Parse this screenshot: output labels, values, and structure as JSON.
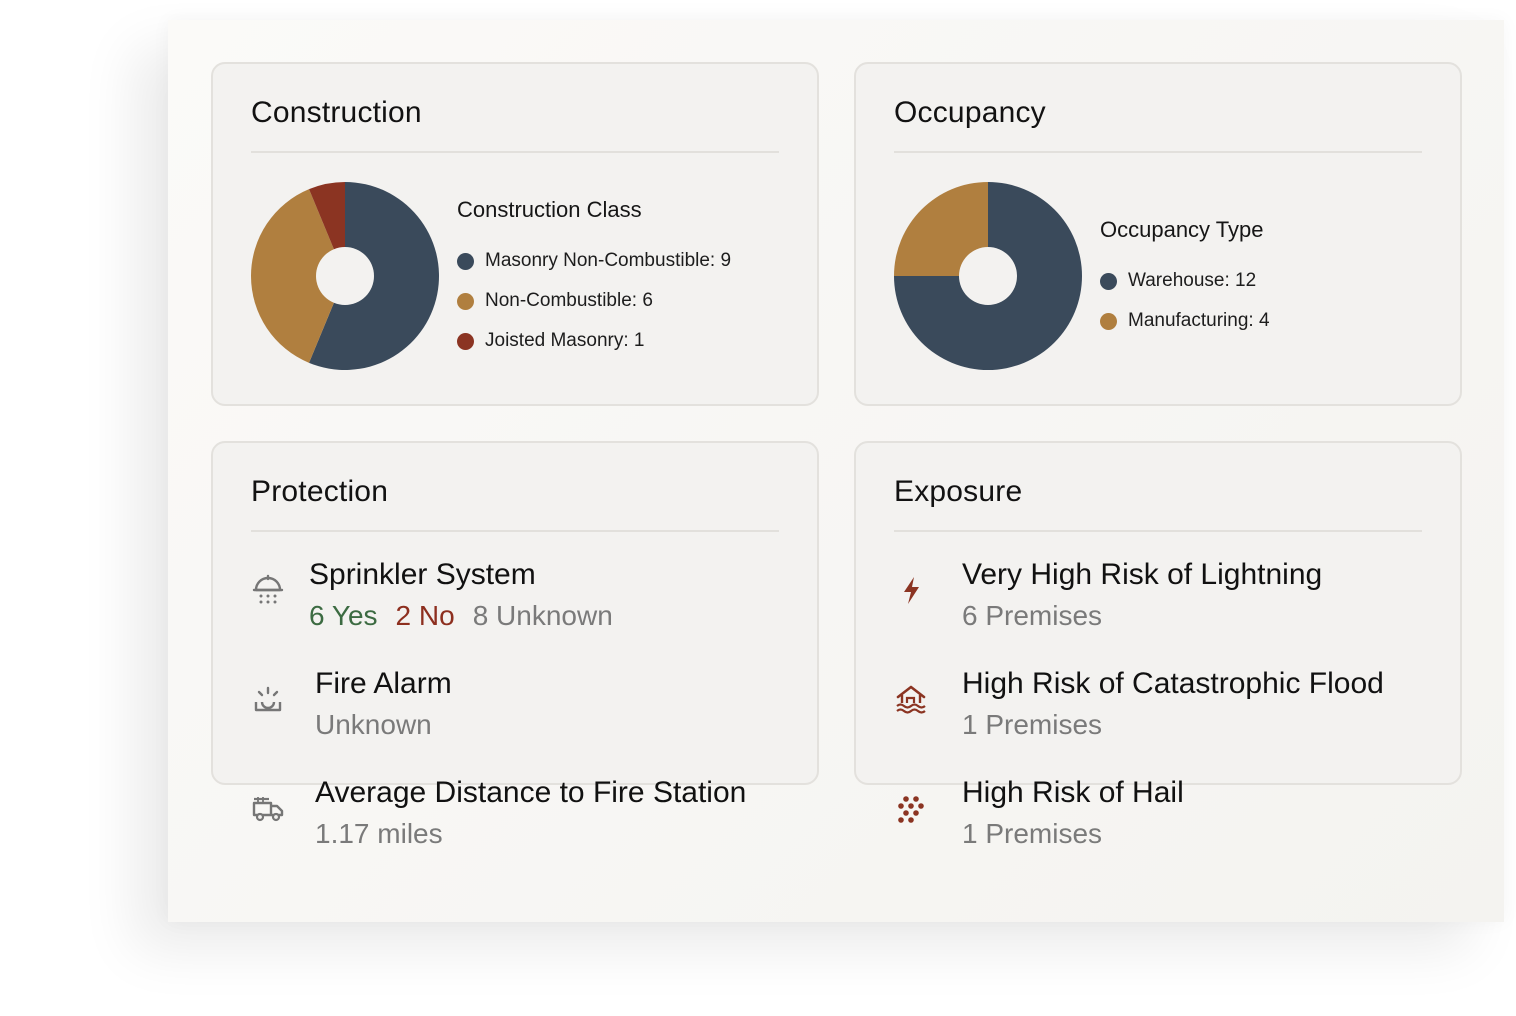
{
  "colors": {
    "navy": "#3a4a5b",
    "tan": "#b07f3f",
    "rust": "#8b3422",
    "green": "#3c6b42",
    "gray_text": "#7a7a7a"
  },
  "construction": {
    "title": "Construction",
    "legend_title": "Construction Class",
    "items": [
      {
        "label": "Masonry Non-Combustible: 9",
        "value": 9,
        "color": "#3a4a5b"
      },
      {
        "label": "Non-Combustible: 6",
        "value": 6,
        "color": "#b07f3f"
      },
      {
        "label": "Joisted Masonry: 1",
        "value": 1,
        "color": "#8b3422"
      }
    ]
  },
  "occupancy": {
    "title": "Occupancy",
    "legend_title": "Occupancy Type",
    "items": [
      {
        "label": "Warehouse: 12",
        "value": 12,
        "color": "#3a4a5b"
      },
      {
        "label": "Manufacturing: 4",
        "value": 4,
        "color": "#b07f3f"
      }
    ]
  },
  "chart_data": [
    {
      "type": "pie",
      "title": "Construction Class",
      "categories": [
        "Masonry Non-Combustible",
        "Non-Combustible",
        "Joisted Masonry"
      ],
      "values": [
        9,
        6,
        1
      ]
    },
    {
      "type": "pie",
      "title": "Occupancy Type",
      "categories": [
        "Warehouse",
        "Manufacturing"
      ],
      "values": [
        12,
        4
      ]
    }
  ],
  "protection": {
    "title": "Protection",
    "sprinkler": {
      "title": "Sprinkler System",
      "yes": "6 Yes",
      "no": "2 No",
      "unknown": "8 Unknown",
      "icon": "sprinkler-icon"
    },
    "fire_alarm": {
      "title": "Fire Alarm",
      "value": "Unknown",
      "icon": "alarm-icon"
    },
    "distance": {
      "title": "Average Distance to Fire Station",
      "value": "1.17 miles",
      "icon": "fire-truck-icon"
    }
  },
  "exposure": {
    "title": "Exposure",
    "items": [
      {
        "title": "Very High Risk of Lightning",
        "value": "6 Premises",
        "icon": "lightning-icon"
      },
      {
        "title": "High Risk of Catastrophic Flood",
        "value": "1 Premises",
        "icon": "flood-icon"
      },
      {
        "title": "High Risk of Hail",
        "value": "1 Premises",
        "icon": "hail-icon"
      }
    ]
  }
}
